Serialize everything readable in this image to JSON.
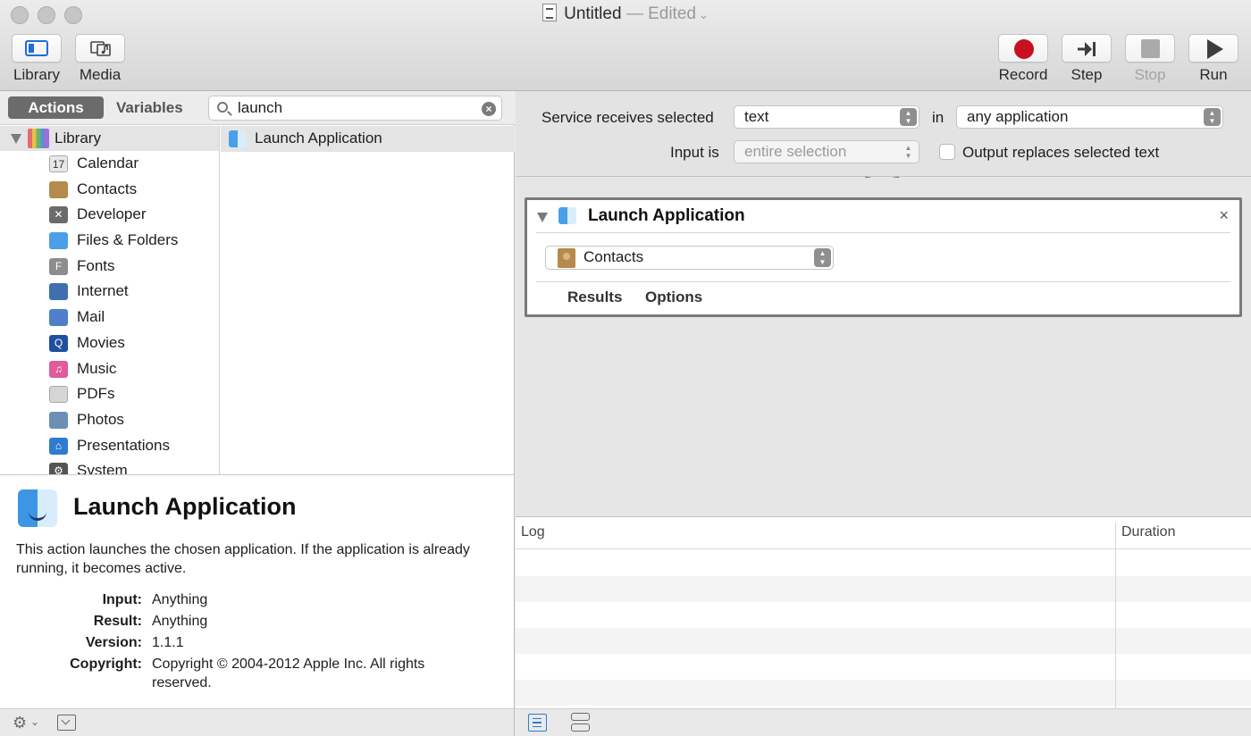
{
  "window": {
    "title": "Untitled",
    "edited": "— Edited",
    "chevron": "⌄"
  },
  "toolbar": {
    "left": [
      {
        "label": "Library",
        "icon": "sidebar-icon"
      },
      {
        "label": "Media",
        "icon": "media-icon"
      }
    ],
    "right": [
      {
        "label": "Record",
        "icon": "record-icon",
        "enabled": true
      },
      {
        "label": "Step",
        "icon": "step-icon",
        "enabled": true
      },
      {
        "label": "Stop",
        "icon": "stop-icon",
        "enabled": false
      },
      {
        "label": "Run",
        "icon": "run-icon",
        "enabled": true
      }
    ]
  },
  "library": {
    "tabs": {
      "actions": "Actions",
      "variables": "Variables"
    },
    "search": {
      "value": "launch",
      "clear_glyph": "×"
    },
    "root_label": "Library",
    "categories": [
      {
        "label": "Calendar",
        "icon": "calendar-icon",
        "color": "#e8e8e8",
        "glyph": "17"
      },
      {
        "label": "Contacts",
        "icon": "contacts-icon",
        "color": "#b58a4c",
        "glyph": ""
      },
      {
        "label": "Developer",
        "icon": "tools-icon",
        "color": "#6b6b6b",
        "glyph": "✕"
      },
      {
        "label": "Files & Folders",
        "icon": "finder-icon",
        "color": "#4a9fe8",
        "glyph": ""
      },
      {
        "label": "Fonts",
        "icon": "fonts-icon",
        "color": "#8d8d8d",
        "glyph": "F"
      },
      {
        "label": "Internet",
        "icon": "globe-icon",
        "color": "#3f6fb0",
        "glyph": ""
      },
      {
        "label": "Mail",
        "icon": "mail-icon",
        "color": "#4f7fc8",
        "glyph": ""
      },
      {
        "label": "Movies",
        "icon": "quicktime-icon",
        "color": "#1f4fa0",
        "glyph": "Q"
      },
      {
        "label": "Music",
        "icon": "music-icon",
        "color": "#e05a9c",
        "glyph": "♫"
      },
      {
        "label": "PDFs",
        "icon": "pdf-icon",
        "color": "#d5d5d5",
        "glyph": ""
      },
      {
        "label": "Photos",
        "icon": "photos-icon",
        "color": "#6b8fb5",
        "glyph": ""
      },
      {
        "label": "Presentations",
        "icon": "keynote-icon",
        "color": "#2f7bd1",
        "glyph": "⌂"
      },
      {
        "label": "System",
        "icon": "system-icon",
        "color": "#555555",
        "glyph": "⚙"
      }
    ],
    "results": [
      {
        "label": "Launch Application",
        "icon": "finder-icon"
      }
    ]
  },
  "description": {
    "title": "Launch Application",
    "text": "This action launches the chosen application. If the application is already running, it becomes active.",
    "fields": [
      {
        "key": "Input:",
        "value": "Anything"
      },
      {
        "key": "Result:",
        "value": "Anything"
      },
      {
        "key": "Version:",
        "value": "1.1.1"
      },
      {
        "key": "Copyright:",
        "value": "Copyright © 2004-2012 Apple Inc.  All rights reserved."
      }
    ]
  },
  "service": {
    "receives_label": "Service receives selected",
    "receives_value": "text",
    "in_label": "in",
    "in_value": "any application",
    "input_is_label": "Input is",
    "input_is_value": "entire selection",
    "output_replaces_label": "Output replaces selected text",
    "output_replaces_checked": false
  },
  "action": {
    "title": "Launch Application",
    "close_glyph": "×",
    "app_value": "Contacts",
    "tabs": [
      "Results",
      "Options"
    ]
  },
  "log": {
    "columns": [
      "Log",
      "Duration"
    ]
  },
  "bottom": {
    "gear_glyph": "⚙",
    "chevron_glyph": "⌄"
  },
  "popup_arrows": "▲\n▼"
}
